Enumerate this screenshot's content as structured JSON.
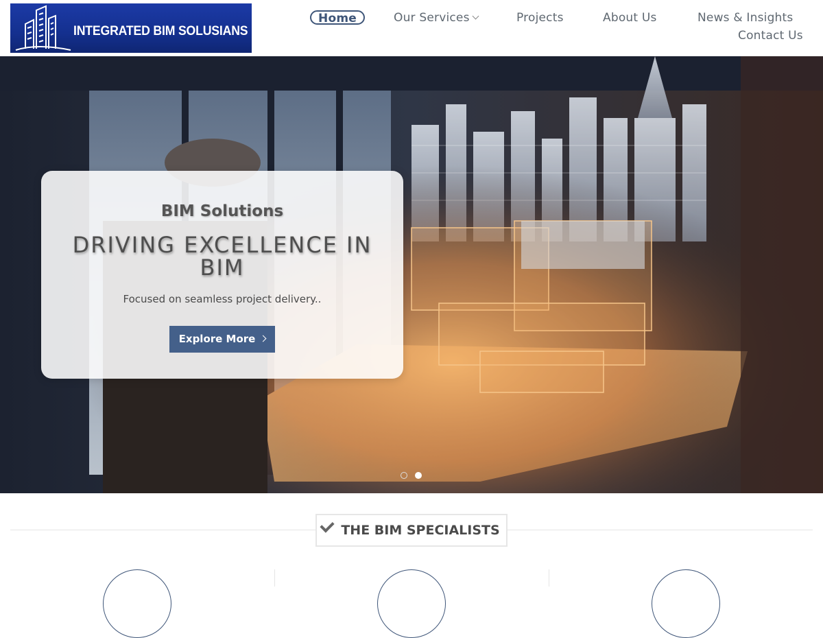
{
  "logo": {
    "text": "INTEGRATED BIM SOLUSIANS"
  },
  "nav": {
    "items": [
      {
        "label": "Home",
        "active": true
      },
      {
        "label": "Our Services",
        "has_dropdown": true
      },
      {
        "label": "Projects"
      },
      {
        "label": "About Us"
      },
      {
        "label": "News & Insights"
      },
      {
        "label": "Contact Us"
      }
    ]
  },
  "hero": {
    "subtitle": "BIM Solutions",
    "title": "DRIVING EXCELLENCE IN BIM",
    "description": "Focused on seamless project delivery..",
    "button_label": "Explore More",
    "slides": {
      "count": 2,
      "active": 2
    }
  },
  "section": {
    "heading": "THE BIM SPECIALISTS",
    "icon": "check-icon",
    "feature_count": 3
  },
  "colors": {
    "accent": "#3e5578",
    "button": "#44608a",
    "logo_bg": "#14308f"
  }
}
